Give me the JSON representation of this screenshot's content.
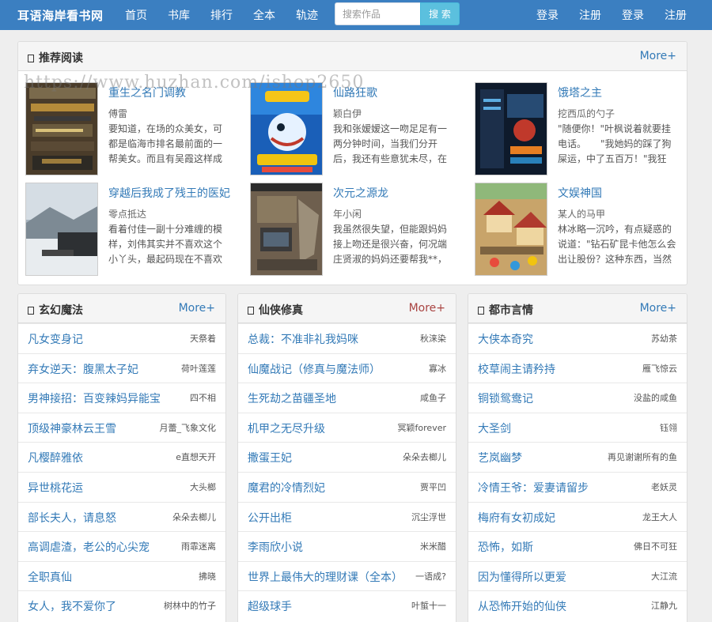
{
  "navbar": {
    "brand": "耳语海岸看书网",
    "items": [
      "首页",
      "书库",
      "排行",
      "全本",
      "轨迹"
    ],
    "search_placeholder": "搜索作品",
    "search_button": "搜 索",
    "right": [
      "登录",
      "注册",
      "登录",
      "注册"
    ]
  },
  "recommend": {
    "title": "推荐阅读",
    "more": "More+",
    "books": [
      {
        "title": "重生之名门调教",
        "author": "傅雷",
        "intro": "要知道，在场的众美女，可都是临海市排名最前面的一帮美女。而且有吴霞这样成熟风韵"
      },
      {
        "title": "仙路狂歌",
        "author": "颖白伊",
        "intro": "我和张嫒嫒这一吻足足有一两分钟时间，当我们分开后，我还有些意犹未尽，在看张嫒"
      },
      {
        "title": "饿塔之主",
        "author": "挖西瓜的勺子",
        "intro": "\"随便你！\"叶枫说着就要挂电话。　　\"我她妈的踩了狗屎运，中了五百万！\"我狂嚷。众"
      },
      {
        "title": "穿越后我成了残王的医妃",
        "author": "零点抵达",
        "intro": "看着付佳一副十分难缠的模样，刘伟其实并不喜欢这个小丫头，最起码现在不喜欢她，"
      },
      {
        "title": "次元之源龙",
        "author": "年小闲",
        "intro": "我虽然很失望，但能跟妈妈接上吻还是很兴奋，何况端庄贤淑的妈妈还要帮我**，这当然"
      },
      {
        "title": "文娱神国",
        "author": "某人的马甲",
        "intro": "林冰略一沉吟，有点疑惑的说道：\"钻石矿昆卡他怎么会出让股份？这种东西，当然是牢牢"
      }
    ]
  },
  "watermark": "https://www.huzhan.com/ishop2650",
  "lists": [
    {
      "title": "玄幻魔法",
      "more": "More+",
      "rows": [
        {
          "t": "凡女变身记",
          "a": "天祭着"
        },
        {
          "t": "弃女逆天：腹黑太子妃",
          "a": "荷叶莲莲"
        },
        {
          "t": "男神接招：百变辣妈异能宝",
          "a": "四不相"
        },
        {
          "t": "顶级神豪林云王雪",
          "a": "月蕾_飞象文化"
        },
        {
          "t": "凡樱醉雅依",
          "a": "e直想天开"
        },
        {
          "t": "异世桃花运",
          "a": "大头榔"
        },
        {
          "t": "部长夫人，请息怒",
          "a": "朵朵去榔儿"
        },
        {
          "t": "高调虐渣，老公的心尖宠",
          "a": "雨霏迷离"
        },
        {
          "t": "全职真仙",
          "a": "拂晓"
        },
        {
          "t": "女人，我不爱你了",
          "a": "树林中的竹子"
        }
      ]
    },
    {
      "title": "仙侠修真",
      "more": "More+",
      "rows": [
        {
          "t": "总裁：不准非礼我妈咪",
          "a": "秋涞染"
        },
        {
          "t": "仙魔战记（修真与魔法师）",
          "a": "寡冰"
        },
        {
          "t": "生死劫之苗疆圣地",
          "a": "咸鱼子"
        },
        {
          "t": "机甲之无尽升级",
          "a": "冥颖forever"
        },
        {
          "t": "撒蛋王妃",
          "a": "朵朵去榔儿"
        },
        {
          "t": "魔君的冷情烈妃",
          "a": "贾平凹"
        },
        {
          "t": "公开出柜",
          "a": "沉尘浮世"
        },
        {
          "t": "李雨欣小说",
          "a": "米米醋"
        },
        {
          "t": "世界上最伟大的理财课（全本）",
          "a": "一语成?"
        },
        {
          "t": "超级球手",
          "a": "叶蜇十一"
        }
      ]
    },
    {
      "title": "都市言情",
      "more": "More+",
      "rows": [
        {
          "t": "大侠本奇究",
          "a": "苏幼茶"
        },
        {
          "t": "校草闹主请矜持",
          "a": "雁飞惊云"
        },
        {
          "t": "铜锁鸳鸯记",
          "a": "没盐的咸鱼"
        },
        {
          "t": "大圣剑",
          "a": "钰翎"
        },
        {
          "t": "艺岚幽梦",
          "a": "再见谢谢所有的鱼"
        },
        {
          "t": "冷情王爷：爱妻请留步",
          "a": "老妖灵"
        },
        {
          "t": "梅府有女初成妃",
          "a": "龙王大人"
        },
        {
          "t": "恐怖，如斯",
          "a": "佛日不可狂"
        },
        {
          "t": "因为懂得所以更爱",
          "a": "大江流"
        },
        {
          "t": "从恐怖开始的仙侠",
          "a": "江静九"
        }
      ]
    }
  ]
}
